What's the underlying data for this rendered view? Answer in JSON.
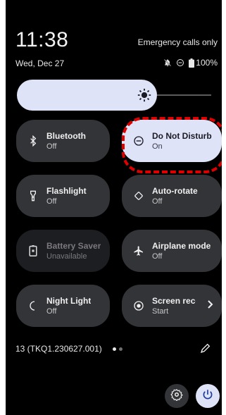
{
  "status_bar": {
    "time": "11:38",
    "date": "Wed, Dec 27",
    "network": "Emergency calls only",
    "battery": "100%",
    "icons": [
      "notifications-off-icon",
      "do-not-disturb-icon",
      "battery-icon"
    ]
  },
  "brightness": {
    "level": 0.72,
    "icon": "brightness-icon"
  },
  "tiles": [
    {
      "id": "bluetooth",
      "title": "Bluetooth",
      "state": "Off",
      "icon": "bluetooth-icon"
    },
    {
      "id": "do-not-disturb",
      "title": "Do Not Disturb",
      "state": "On",
      "icon": "do-not-disturb-icon",
      "active": true,
      "highlighted": true
    },
    {
      "id": "flashlight",
      "title": "Flashlight",
      "state": "Off",
      "icon": "flashlight-icon"
    },
    {
      "id": "auto-rotate",
      "title": "Auto-rotate",
      "state": "Off",
      "icon": "auto-rotate-icon"
    },
    {
      "id": "battery-saver",
      "title": "Battery Saver",
      "state": "Unavailable",
      "icon": "battery-saver-icon",
      "disabled": true
    },
    {
      "id": "airplane-mode",
      "title": "Airplane mode",
      "state": "Off",
      "icon": "airplane-icon"
    },
    {
      "id": "night-light",
      "title": "Night Light",
      "state": "Off",
      "icon": "night-light-icon"
    },
    {
      "id": "screen-record",
      "title": "Screen record",
      "state": "Start",
      "icon": "screen-record-icon",
      "has_chevron": true
    }
  ],
  "footer": {
    "build": "13 (TKQ1.230627.001)",
    "page_dots": 2,
    "current_page": 1,
    "edit_icon": "edit-icon",
    "settings_icon": "settings-icon",
    "power_icon": "power-icon"
  },
  "colors": {
    "background": "#000000",
    "tile": "#333438",
    "tile_active": "#dfe3f8",
    "tile_disabled": "#1d1e21",
    "highlight": "#e10000"
  }
}
